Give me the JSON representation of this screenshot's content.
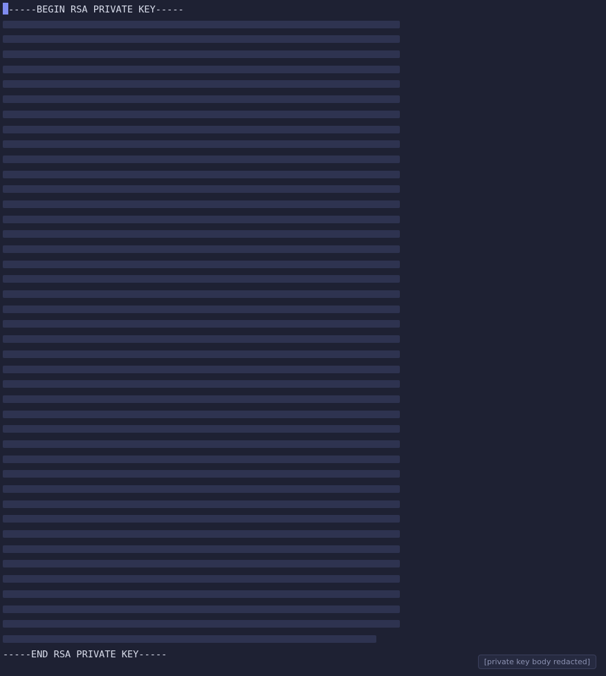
{
  "terminal": {
    "header_line": "-----BEGIN RSA PRIVATE KEY-----",
    "footer_line": "-----END RSA PRIVATE KEY-----",
    "body_line_count": 42,
    "body_redacted": true,
    "redaction_note": "[private key body redacted]"
  }
}
